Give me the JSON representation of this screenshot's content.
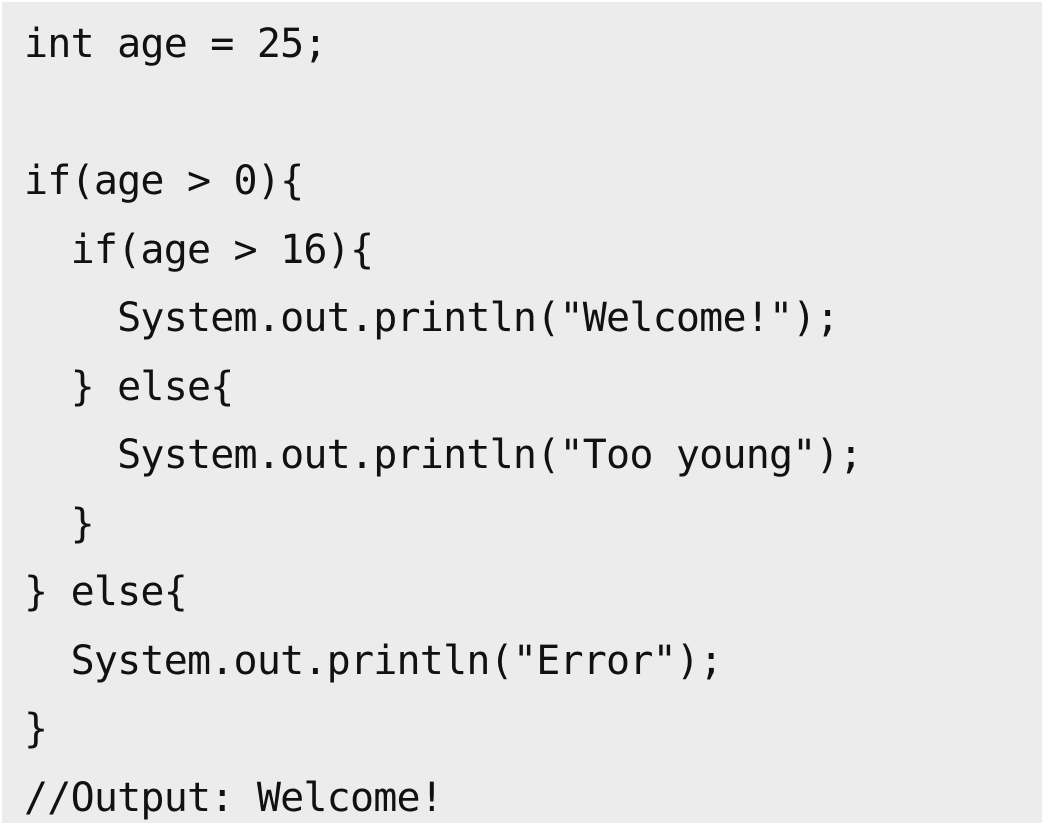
{
  "code": {
    "lines": [
      "int age = 25;",
      "",
      "if(age > 0){",
      "  if(age > 16){",
      "    System.out.println(\"Welcome!\");",
      "  } else{",
      "    System.out.println(\"Too young\");",
      "  }",
      "} else{",
      "  System.out.println(\"Error\");",
      "}",
      "//Output: Welcome!"
    ]
  }
}
